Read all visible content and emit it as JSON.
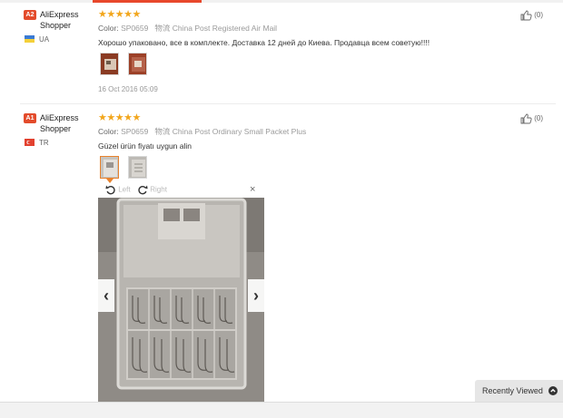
{
  "reviews": [
    {
      "badge": "A2",
      "name": "AliExpress Shopper",
      "country": "UA",
      "stars": "★★★★★",
      "color_label": "Color:",
      "color_value": "SP0659",
      "logistics_label": "物流",
      "logistics": "China Post Registered Air Mail",
      "text": "Хорошо упаковано, все в комплекте. Доставка 12 дней до Киева. Продавца всем советую!!!!",
      "date": "16 Oct 2016 05:09",
      "helpful": "(0)"
    },
    {
      "badge": "A1",
      "name": "AliExpress Shopper",
      "country": "TR",
      "stars": "★★★★★",
      "color_label": "Color:",
      "color_value": "SP0659",
      "logistics_label": "物流",
      "logistics": "China Post Ordinary Small Packet Plus",
      "text": "Güzel ürün fiyatı uygun alin",
      "helpful": "(0)"
    }
  ],
  "viewer": {
    "rotate_left": "Left",
    "rotate_right": "Right",
    "close": "×",
    "prev": "‹",
    "next": "›"
  },
  "recently_viewed": {
    "label": "Recently Viewed"
  },
  "colors": {
    "accent": "#e8482c",
    "stars": "#f2a61c",
    "badge": "#e34b2b"
  }
}
